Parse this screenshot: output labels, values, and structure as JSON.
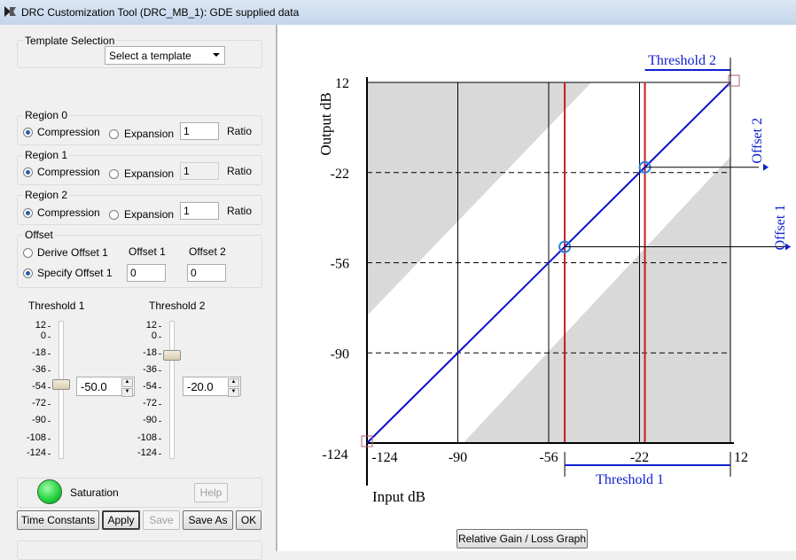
{
  "window": {
    "title": "DRC Customization Tool (DRC_MB_1):  GDE supplied data"
  },
  "template": {
    "group_label": "Template Selection",
    "selected": "Select a template"
  },
  "regions": [
    {
      "label": "Region 0",
      "compression": "Compression",
      "expansion": "Expansion",
      "ratio_value": "1",
      "ratio_label": "Ratio",
      "ratio_enabled": true
    },
    {
      "label": "Region 1",
      "compression": "Compression",
      "expansion": "Expansion",
      "ratio_value": "1",
      "ratio_label": "Ratio",
      "ratio_enabled": false
    },
    {
      "label": "Region 2",
      "compression": "Compression",
      "expansion": "Expansion",
      "ratio_value": "1",
      "ratio_label": "Ratio",
      "ratio_enabled": true
    }
  ],
  "offset": {
    "group_label": "Offset",
    "derive_label": "Derive Offset 1",
    "specify_label": "Specify Offset 1",
    "offset1_label": "Offset 1",
    "offset2_label": "Offset 2",
    "offset1_value": "0",
    "offset2_value": "0"
  },
  "threshold1": {
    "label": "Threshold 1",
    "value": "-50.0"
  },
  "threshold2": {
    "label": "Threshold 2",
    "value": "-20.0"
  },
  "slider_ticks": [
    "12",
    "0",
    "-18",
    "-36",
    "-54",
    "-72",
    "-90",
    "-108",
    "-124"
  ],
  "saturation": {
    "label": "Saturation",
    "help_label": "Help"
  },
  "buttons": {
    "time_constants": "Time Constants",
    "apply": "Apply",
    "save": "Save",
    "save_as": "Save As",
    "ok": "OK"
  },
  "graph_button": "Relative Gain / Loss Graph",
  "chart_data": {
    "type": "line",
    "xlabel": "Input dB",
    "ylabel": "Output dB",
    "x_ticks": [
      "-124",
      "-90",
      "-56",
      "-22",
      "12"
    ],
    "y_ticks": [
      "12",
      "-22",
      "-56",
      "-90",
      "-124"
    ],
    "xlim": [
      -124,
      12
    ],
    "ylim": [
      -124,
      12
    ],
    "series": [
      {
        "x": [
          -124,
          -50,
          -20,
          12
        ],
        "y": [
          -124,
          -50,
          -20,
          12
        ]
      }
    ],
    "thresholds": [
      -50,
      -20
    ],
    "threshold_labels": [
      "Threshold 1",
      "Threshold 2"
    ],
    "offset_labels": [
      "Offset 1",
      "Offset 2"
    ],
    "grid_x": [
      -90,
      -56,
      -22
    ],
    "grid_y": [
      -22,
      -56,
      -90
    ],
    "colors": {
      "curve": "#1010cc",
      "threshold": "#c02020",
      "annotation": "#1020d0",
      "shade": "#d9d9d9"
    }
  }
}
